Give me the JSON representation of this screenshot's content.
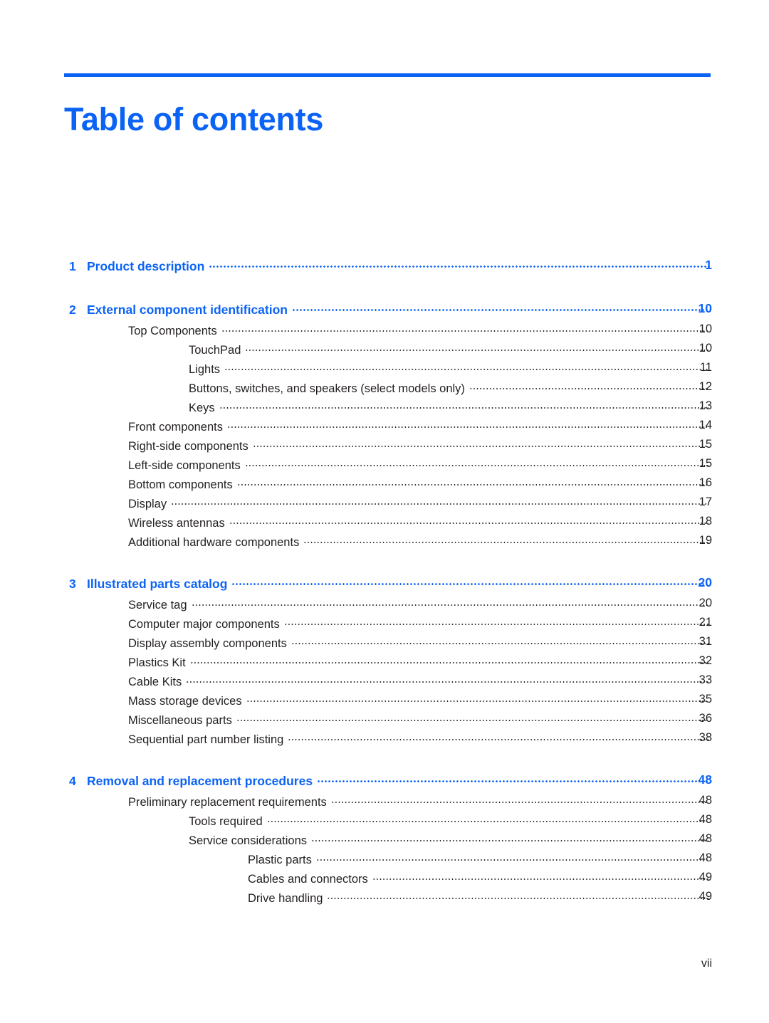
{
  "document": {
    "title": "Table of contents",
    "folio": "vii"
  },
  "toc": {
    "entries": [
      {
        "level": 0,
        "number": "1",
        "label": "Product description",
        "page": "1",
        "gap_before": false
      },
      {
        "level": 0,
        "number": "2",
        "label": "External component identification",
        "page": "10",
        "gap_before": true
      },
      {
        "level": 1,
        "number": "",
        "label": "Top Components",
        "page": "10",
        "gap_before": false
      },
      {
        "level": 2,
        "number": "",
        "label": "TouchPad",
        "page": "10",
        "gap_before": false
      },
      {
        "level": 2,
        "number": "",
        "label": "Lights",
        "page": "11",
        "gap_before": false
      },
      {
        "level": 2,
        "number": "",
        "label": "Buttons, switches, and speakers (select models only)",
        "page": "12",
        "gap_before": false
      },
      {
        "level": 2,
        "number": "",
        "label": "Keys",
        "page": "13",
        "gap_before": false
      },
      {
        "level": 1,
        "number": "",
        "label": "Front components",
        "page": "14",
        "gap_before": false
      },
      {
        "level": 1,
        "number": "",
        "label": "Right-side components",
        "page": "15",
        "gap_before": false
      },
      {
        "level": 1,
        "number": "",
        "label": "Left-side components",
        "page": "15",
        "gap_before": false
      },
      {
        "level": 1,
        "number": "",
        "label": "Bottom components",
        "page": "16",
        "gap_before": false
      },
      {
        "level": 1,
        "number": "",
        "label": "Display",
        "page": "17",
        "gap_before": false
      },
      {
        "level": 1,
        "number": "",
        "label": "Wireless antennas",
        "page": "18",
        "gap_before": false
      },
      {
        "level": 1,
        "number": "",
        "label": "Additional hardware components",
        "page": "19",
        "gap_before": false
      },
      {
        "level": 0,
        "number": "3",
        "label": "Illustrated parts catalog",
        "page": "20",
        "gap_before": true
      },
      {
        "level": 1,
        "number": "",
        "label": "Service tag",
        "page": "20",
        "gap_before": false
      },
      {
        "level": 1,
        "number": "",
        "label": "Computer major components",
        "page": "21",
        "gap_before": false
      },
      {
        "level": 1,
        "number": "",
        "label": "Display assembly components",
        "page": "31",
        "gap_before": false
      },
      {
        "level": 1,
        "number": "",
        "label": "Plastics Kit",
        "page": "32",
        "gap_before": false
      },
      {
        "level": 1,
        "number": "",
        "label": "Cable Kits",
        "page": "33",
        "gap_before": false
      },
      {
        "level": 1,
        "number": "",
        "label": "Mass storage devices",
        "page": "35",
        "gap_before": false
      },
      {
        "level": 1,
        "number": "",
        "label": "Miscellaneous parts",
        "page": "36",
        "gap_before": false
      },
      {
        "level": 1,
        "number": "",
        "label": "Sequential part number listing",
        "page": "38",
        "gap_before": false
      },
      {
        "level": 0,
        "number": "4",
        "label": "Removal and replacement procedures",
        "page": "48",
        "gap_before": true
      },
      {
        "level": 1,
        "number": "",
        "label": "Preliminary replacement requirements",
        "page": "48",
        "gap_before": false
      },
      {
        "level": 2,
        "number": "",
        "label": "Tools required",
        "page": "48",
        "gap_before": false
      },
      {
        "level": 2,
        "number": "",
        "label": "Service considerations",
        "page": "48",
        "gap_before": false
      },
      {
        "level": 3,
        "number": "",
        "label": "Plastic parts",
        "page": "48",
        "gap_before": false
      },
      {
        "level": 3,
        "number": "",
        "label": "Cables and connectors",
        "page": "49",
        "gap_before": false
      },
      {
        "level": 3,
        "number": "",
        "label": "Drive handling",
        "page": "49",
        "gap_before": false
      }
    ]
  },
  "colors": {
    "accent_blue": "#0b63f6",
    "body_text": "#231f20",
    "background": "#ffffff"
  }
}
